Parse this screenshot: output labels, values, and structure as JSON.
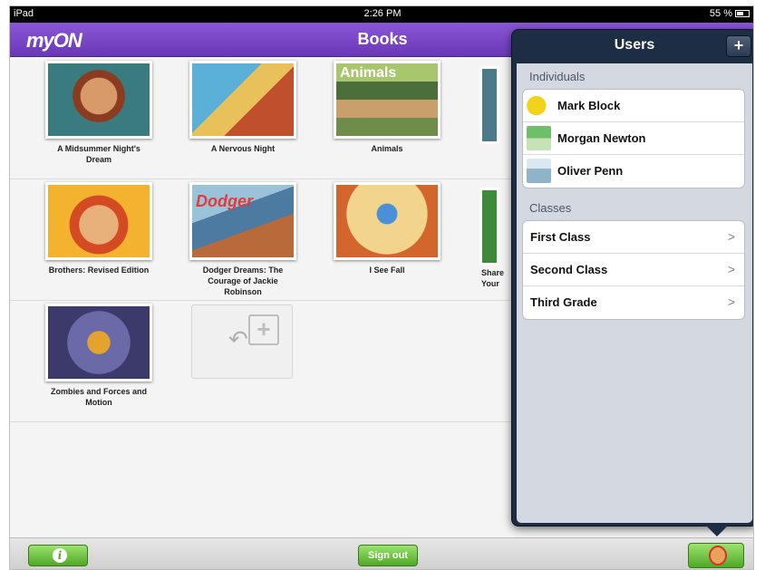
{
  "status_bar": {
    "device": "iPad",
    "time": "2:26 PM",
    "battery": "55 %"
  },
  "nav_bar": {
    "logo": "myON",
    "title": "Books"
  },
  "books": [
    {
      "title": "A Midsummer Night's Dream"
    },
    {
      "title": "A Nervous Night"
    },
    {
      "title": "Animals",
      "cover_text": "Animals"
    },
    {
      "title": "Brothers: Revised Edition"
    },
    {
      "title": "Dodger Dreams: The Courage of Jackie Robinson",
      "cover_text": "Dodger"
    },
    {
      "title": "I See Fall"
    },
    {
      "title": "Zombies and Forces and Motion"
    }
  ],
  "partial_books": {
    "row2_partial_title": "Share\nYour"
  },
  "popover": {
    "title": "Users",
    "add_label": "+",
    "individuals_label": "Individuals",
    "individuals": [
      {
        "name": "Mark Block"
      },
      {
        "name": "Morgan Newton"
      },
      {
        "name": "Oliver Penn"
      }
    ],
    "classes_label": "Classes",
    "classes": [
      {
        "name": "First Class"
      },
      {
        "name": "Second Class"
      },
      {
        "name": "Third Grade"
      }
    ]
  },
  "toolbar": {
    "info_label": "i",
    "signout_label": "Sign out"
  },
  "colors": {
    "nav_purple": "#7a48c7",
    "accent_green": "#4fa826",
    "popover_navy": "#1d2d44"
  }
}
